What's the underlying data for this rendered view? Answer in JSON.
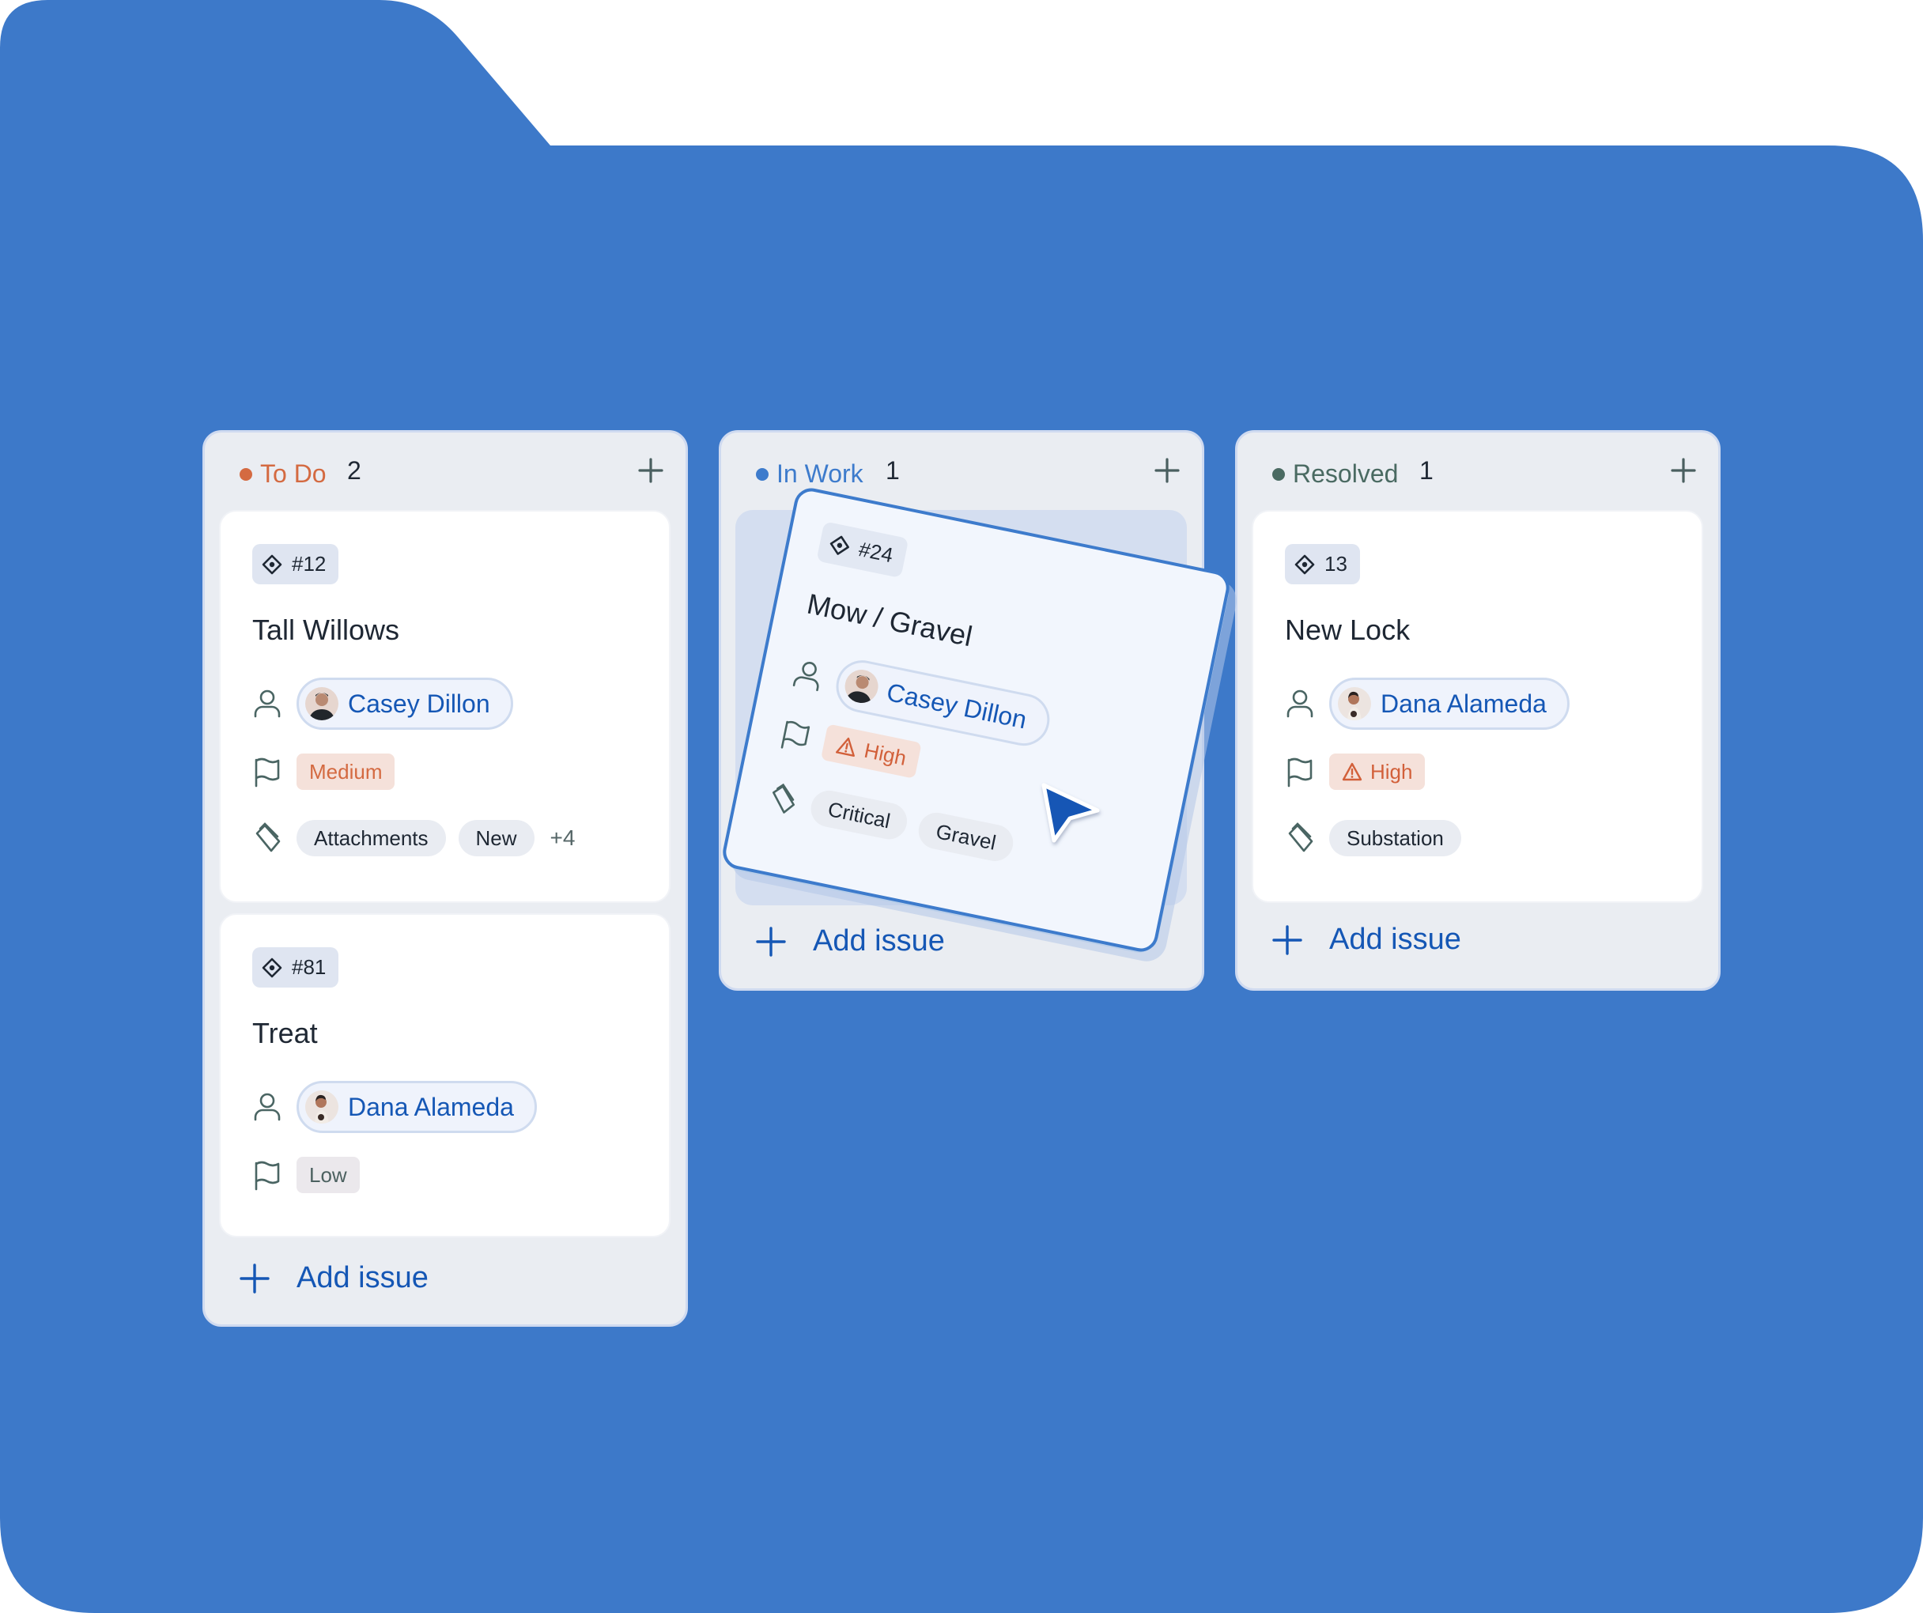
{
  "colors": {
    "folder": "#3d79c9",
    "todo": "#d46a41",
    "inwork": "#3d7bcc",
    "resolved": "#4a6a62",
    "link": "#1557b5",
    "text": "#1e2733"
  },
  "columns": [
    {
      "title": "To Do",
      "count": "2",
      "add_icon": "plus-icon",
      "add_issue_label": "Add issue",
      "cards": [
        {
          "id": "#12",
          "id_icon": "issue-diamond-icon",
          "title": "Tall Willows",
          "assignee": "Casey Dillon",
          "priority": "Medium",
          "tags": [
            "Attachments",
            "New"
          ],
          "tags_more": "+4"
        },
        {
          "id": "#81",
          "id_icon": "issue-diamond-icon",
          "title": "Treat",
          "assignee": "Dana Alameda",
          "priority": "Low"
        }
      ]
    },
    {
      "title": "In Work",
      "count": "1",
      "add_icon": "plus-icon",
      "add_issue_label": "Add issue",
      "dragging_card": {
        "id": "#24",
        "id_icon": "issue-diamond-icon",
        "title": "Mow / Gravel",
        "assignee": "Casey Dillon",
        "priority": "High",
        "priority_icon": "warning-triangle-icon",
        "tags": [
          "Critical",
          "Gravel"
        ]
      }
    },
    {
      "title": "Resolved",
      "count": "1",
      "add_icon": "plus-icon",
      "add_issue_label": "Add issue",
      "cards": [
        {
          "id": "13",
          "id_icon": "issue-diamond-icon",
          "title": "New Lock",
          "assignee": "Dana Alameda",
          "priority": "High",
          "priority_icon": "warning-triangle-icon",
          "tags": [
            "Substation"
          ]
        }
      ]
    }
  ]
}
